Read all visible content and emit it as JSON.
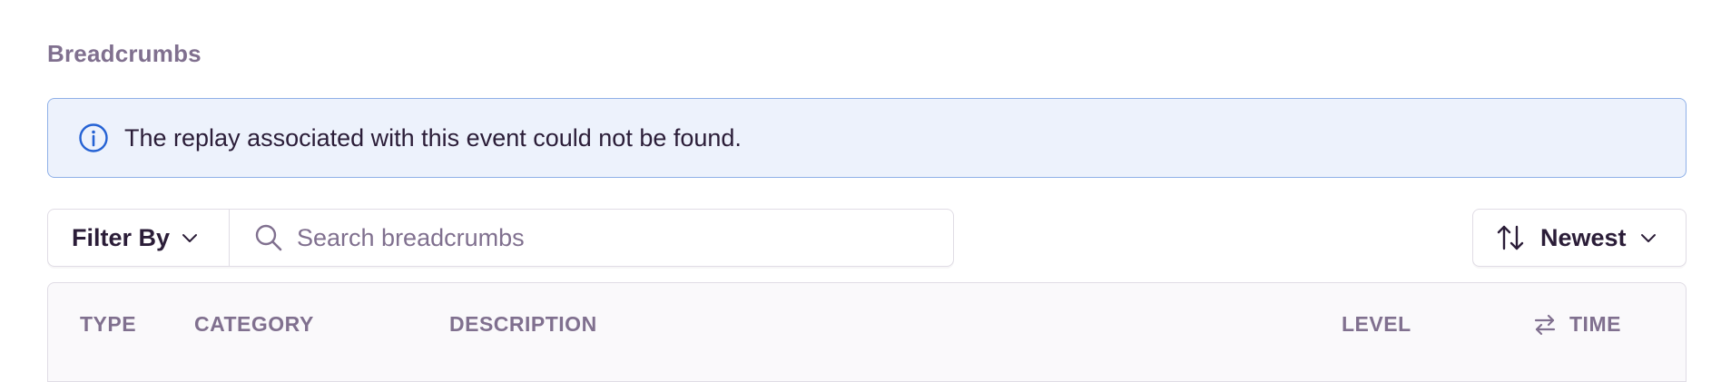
{
  "section": {
    "title": "Breadcrumbs"
  },
  "alert": {
    "icon": "info-icon",
    "message": "The replay associated with this event could not be found."
  },
  "filter": {
    "label": "Filter By",
    "icon": "chevron-down-icon"
  },
  "search": {
    "placeholder": "Search breadcrumbs",
    "value": "",
    "icon": "search-icon"
  },
  "sort": {
    "label": "Newest",
    "icon": "sort-arrows-icon",
    "chevron": "chevron-down-icon"
  },
  "table": {
    "columns": {
      "type": "TYPE",
      "category": "CATEGORY",
      "description": "DESCRIPTION",
      "level": "LEVEL",
      "time": "TIME"
    },
    "time_icon": "swap-arrows-icon"
  },
  "colors": {
    "muted_text": "#80708f",
    "body_text": "#2b1d38",
    "alert_bg": "#edf2fc",
    "alert_border": "#8fb0e8",
    "info_icon": "#2562d4",
    "border": "#e0dce5"
  }
}
